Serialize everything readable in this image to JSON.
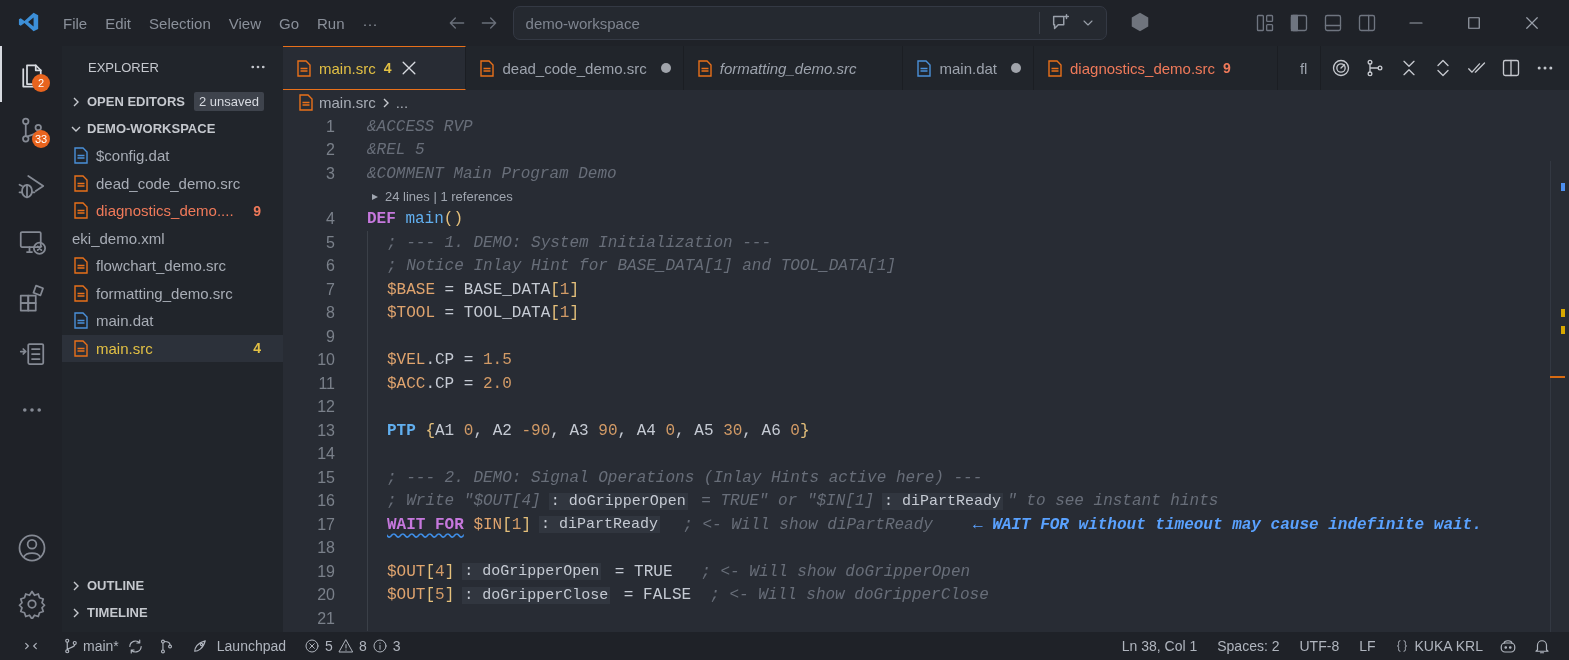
{
  "title_bar": {
    "menus": [
      "File",
      "Edit",
      "Selection",
      "View",
      "Go",
      "Run",
      "···"
    ],
    "search": {
      "value": "demo-workspace"
    }
  },
  "activity_bar": {
    "items": [
      {
        "kind": "files",
        "selected": true,
        "badge": "2"
      },
      {
        "kind": "source-control",
        "selected": false,
        "badge": "33"
      },
      {
        "kind": "run-debug",
        "selected": false
      },
      {
        "kind": "remote",
        "selected": false
      },
      {
        "kind": "extensions",
        "selected": false
      },
      {
        "kind": "checklist",
        "selected": false
      },
      {
        "kind": "more",
        "selected": false
      }
    ],
    "bottom": [
      {
        "kind": "account"
      },
      {
        "kind": "settings"
      }
    ]
  },
  "sidebar": {
    "title": "EXPLORER",
    "sections": [
      {
        "label": "OPEN EDITORS",
        "expanded": false,
        "badge": "2 unsaved"
      },
      {
        "label": "DEMO-WORKSPACE",
        "expanded": true
      }
    ],
    "files": [
      {
        "label": "$config.dat",
        "kind": "dat",
        "color": "#a8adb6",
        "selected": false
      },
      {
        "label": "dead_code_demo.src",
        "kind": "src",
        "color": "#a8adb6",
        "selected": false
      },
      {
        "label": "diagnostics_demo....",
        "kind": "src",
        "color": "#f07a5a",
        "problems": "9",
        "selected": false
      },
      {
        "label": "eki_demo.xml",
        "kind": "plain",
        "color": "#a8adb6",
        "selected": false
      },
      {
        "label": "flowchart_demo.src",
        "kind": "src",
        "color": "#a8adb6",
        "selected": false
      },
      {
        "label": "formatting_demo.src",
        "kind": "src",
        "color": "#a8adb6",
        "selected": false
      },
      {
        "label": "main.dat",
        "kind": "dat",
        "color": "#a8adb6",
        "selected": false
      },
      {
        "label": "main.src",
        "kind": "src",
        "color": "#e2c044",
        "problems": "4",
        "selected": true
      }
    ],
    "bottom_sections": [
      {
        "label": "OUTLINE",
        "expanded": false
      },
      {
        "label": "TIMELINE",
        "expanded": false
      }
    ]
  },
  "tabs": [
    {
      "label": "main.src",
      "kind": "src",
      "color": "#e2c044",
      "problems": "4",
      "selected": true,
      "dirty": false,
      "preview": false
    },
    {
      "label": "dead_code_demo.src",
      "kind": "src",
      "color": "#9da3ad",
      "selected": false,
      "dirty": true,
      "preview": false
    },
    {
      "label": "formatting_demo.src",
      "kind": "src",
      "color": "#9da3ad",
      "selected": false,
      "dirty": false,
      "preview": true
    },
    {
      "label": "main.dat",
      "kind": "dat",
      "color": "#9da3ad",
      "selected": false,
      "dirty": true,
      "preview": false
    },
    {
      "label": "diagnostics_demo.src",
      "kind": "src",
      "color": "#f07a5a",
      "problems": "9",
      "selected": false,
      "dirty": false,
      "preview": false
    },
    {
      "label": "fl",
      "kind": "src",
      "color": "#9da3ad",
      "selected": false,
      "dirty": false,
      "preview": false
    }
  ],
  "breadcrumbs": [
    "main.src",
    "..."
  ],
  "code": [
    {
      "kind": "code",
      "number": "1",
      "indented": false,
      "tokens": [
        {
          "kind": "comment",
          "text": "&ACCESS RVP"
        }
      ]
    },
    {
      "kind": "code",
      "number": "2",
      "indented": false,
      "tokens": [
        {
          "kind": "comment",
          "text": "&REL 5"
        }
      ]
    },
    {
      "kind": "code",
      "number": "3",
      "indented": false,
      "tokens": [
        {
          "kind": "comment",
          "text": "&COMMENT Main Program Demo"
        }
      ]
    },
    {
      "kind": "codelens",
      "text": "24 lines | 1 references"
    },
    {
      "kind": "code",
      "number": "4",
      "indented": false,
      "tokens": [
        {
          "kind": "keyword",
          "text": "DEF"
        },
        {
          "kind": "function",
          "text": " main"
        },
        {
          "kind": "bracket",
          "text": "()"
        }
      ]
    },
    {
      "kind": "code",
      "number": "5",
      "indented": true,
      "tokens": [
        {
          "kind": "comment",
          "text": "; --- 1. DEMO: System Initialization ---"
        }
      ]
    },
    {
      "kind": "code",
      "number": "6",
      "indented": true,
      "tokens": [
        {
          "kind": "comment",
          "text": "; Notice Inlay Hint for BASE_DATA[1] and TOOL_DATA[1]"
        }
      ]
    },
    {
      "kind": "code",
      "number": "7",
      "indented": true,
      "tokens": [
        {
          "kind": "variable",
          "text": "$BASE"
        },
        {
          "kind": "plain",
          "text": " = BASE_DATA"
        },
        {
          "kind": "bracket",
          "text": "["
        },
        {
          "kind": "number",
          "text": "1"
        },
        {
          "kind": "bracket",
          "text": "]"
        }
      ]
    },
    {
      "kind": "code",
      "number": "8",
      "indented": true,
      "tokens": [
        {
          "kind": "variable",
          "text": "$TOOL"
        },
        {
          "kind": "plain",
          "text": " = TOOL_DATA"
        },
        {
          "kind": "bracket",
          "text": "["
        },
        {
          "kind": "number",
          "text": "1"
        },
        {
          "kind": "bracket",
          "text": "]"
        }
      ]
    },
    {
      "kind": "code",
      "number": "9",
      "indented": true
    },
    {
      "kind": "code",
      "number": "10",
      "indented": true,
      "tokens": [
        {
          "kind": "variable",
          "text": "$VEL"
        },
        {
          "kind": "plain",
          "text": ".CP = "
        },
        {
          "kind": "number",
          "text": "1.5"
        }
      ]
    },
    {
      "kind": "code",
      "number": "11",
      "indented": true,
      "tokens": [
        {
          "kind": "variable",
          "text": "$ACC"
        },
        {
          "kind": "plain",
          "text": ".CP = "
        },
        {
          "kind": "number",
          "text": "2.0"
        }
      ]
    },
    {
      "kind": "code",
      "number": "12",
      "indented": true
    },
    {
      "kind": "code",
      "number": "13",
      "indented": true,
      "tokens": [
        {
          "kind": "keyword2",
          "text": "PTP"
        },
        {
          "kind": "bracket",
          "text": " {"
        },
        {
          "kind": "plain",
          "text": "A1 "
        },
        {
          "kind": "number",
          "text": "0"
        },
        {
          "kind": "plain",
          "text": ", A2 "
        },
        {
          "kind": "number",
          "text": "-90"
        },
        {
          "kind": "plain",
          "text": ", A3 "
        },
        {
          "kind": "number",
          "text": "90"
        },
        {
          "kind": "plain",
          "text": ", A4 "
        },
        {
          "kind": "number",
          "text": "0"
        },
        {
          "kind": "plain",
          "text": ", A5 "
        },
        {
          "kind": "number",
          "text": "30"
        },
        {
          "kind": "plain",
          "text": ", A6 "
        },
        {
          "kind": "number",
          "text": "0"
        },
        {
          "kind": "bracket",
          "text": "}"
        }
      ]
    },
    {
      "kind": "code",
      "number": "14",
      "indented": true
    },
    {
      "kind": "code",
      "number": "15",
      "indented": true,
      "tokens": [
        {
          "kind": "comment",
          "text": "; --- 2. DEMO: Signal Operations (Inlay Hints active here) ---"
        }
      ]
    },
    {
      "kind": "code",
      "number": "16",
      "indented": true,
      "tokens": [
        {
          "kind": "comment",
          "text": "; Write \"$OUT[4]"
        },
        {
          "kind": "hint",
          "text": ": doGripperOpen"
        },
        {
          "kind": "comment",
          "text": " = TRUE\" or \"$IN[1]"
        },
        {
          "kind": "hint",
          "text": ": diPartReady"
        },
        {
          "kind": "comment",
          "text": "\" to see instant hints"
        }
      ]
    },
    {
      "kind": "code",
      "number": "17",
      "indented": true,
      "tokens": [
        {
          "kind": "warning_keyword",
          "text": "WAIT FOR"
        },
        {
          "kind": "variable",
          "text": " $IN"
        },
        {
          "kind": "bracket",
          "text": "["
        },
        {
          "kind": "number",
          "text": "1"
        },
        {
          "kind": "bracket",
          "text": "]"
        },
        {
          "kind": "hint",
          "text": ": diPartReady"
        },
        {
          "kind": "comment",
          "text": "  ; <- Will show diPartReady"
        },
        {
          "kind": "diagnostic",
          "text": "← WAIT FOR without timeout may cause indefinite wait."
        }
      ]
    },
    {
      "kind": "code",
      "number": "18",
      "indented": true
    },
    {
      "kind": "code",
      "number": "19",
      "indented": true,
      "tokens": [
        {
          "kind": "variable",
          "text": "$OUT"
        },
        {
          "kind": "bracket",
          "text": "["
        },
        {
          "kind": "number",
          "text": "4"
        },
        {
          "kind": "bracket",
          "text": "]"
        },
        {
          "kind": "hint",
          "text": ": doGripperOpen"
        },
        {
          "kind": "plain",
          "text": " = TRUE"
        },
        {
          "kind": "comment",
          "text": "   ; <- Will show doGripperOpen"
        }
      ]
    },
    {
      "kind": "code",
      "number": "20",
      "indented": true,
      "tokens": [
        {
          "kind": "variable",
          "text": "$OUT"
        },
        {
          "kind": "bracket",
          "text": "["
        },
        {
          "kind": "number",
          "text": "5"
        },
        {
          "kind": "bracket",
          "text": "]"
        },
        {
          "kind": "hint",
          "text": ": doGripperClose"
        },
        {
          "kind": "plain",
          "text": " = FALSE"
        },
        {
          "kind": "comment",
          "text": "  ; <- Will show doGripperClose"
        }
      ]
    },
    {
      "kind": "code",
      "number": "21",
      "indented": true
    }
  ],
  "status_bar": {
    "branch": "main*",
    "launchpad": "Launchpad",
    "errors": "5",
    "warnings": "8",
    "infos": "3",
    "right": [
      {
        "kind": "text",
        "text": "Ln 38, Col 1"
      },
      {
        "kind": "text",
        "text": "Spaces: 2"
      },
      {
        "kind": "text",
        "text": "UTF-8"
      },
      {
        "kind": "text",
        "text": "LF"
      },
      {
        "kind": "language",
        "text": "KUKA KRL"
      }
    ]
  }
}
